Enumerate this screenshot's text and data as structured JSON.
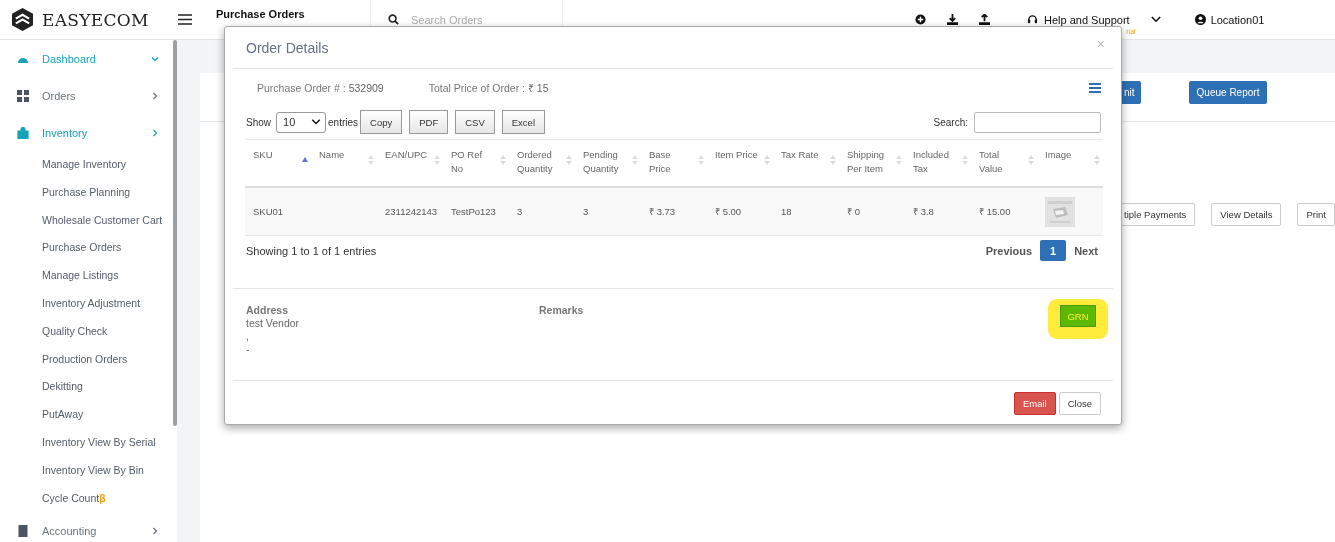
{
  "header": {
    "logo": "EASYECOM",
    "page_title": "Purchase Orders",
    "search": {
      "placeholder": "Search Orders"
    },
    "help": "Help and Support",
    "help_badge": "rial",
    "location": "Location01"
  },
  "sidebar": {
    "items": [
      {
        "label": "Dashboard",
        "active": true,
        "expanded": true
      },
      {
        "label": "Orders",
        "active": false,
        "expanded": false
      },
      {
        "label": "Inventory",
        "active": true,
        "expanded": false,
        "children": [
          {
            "label": "Manage Inventory"
          },
          {
            "label": "Purchase Planning"
          },
          {
            "label": "Wholesale Customer Cart"
          },
          {
            "label": "Purchase Orders"
          },
          {
            "label": "Manage Listings"
          },
          {
            "label": "Inventory Adjustment"
          },
          {
            "label": "Quality Check"
          },
          {
            "label": "Production Orders"
          },
          {
            "label": "Dekitting"
          },
          {
            "label": "PutAway"
          },
          {
            "label": "Inventory View By Serial"
          },
          {
            "label": "Inventory View By Bin"
          },
          {
            "label": "Cycle Count",
            "badge": "β"
          }
        ]
      },
      {
        "label": "Accounting",
        "active": false,
        "expanded": false
      }
    ]
  },
  "background_page": {
    "top_buttons": [
      {
        "label": "nit",
        "kind": "primary"
      },
      {
        "label": "Queue Report",
        "kind": "primary"
      }
    ],
    "row_buttons": [
      {
        "label": "tiple Payments"
      },
      {
        "label": "View Details"
      },
      {
        "label": "Print"
      }
    ]
  },
  "modal": {
    "title": "Order Details",
    "close": "×",
    "po_label": "Purchase Order # :",
    "po_value": "532909",
    "total_label": "Total Price of Order :",
    "total_value": "₹ 15",
    "show_label": "Show",
    "page_size": "10",
    "entries_label": "entries",
    "export_buttons": [
      "Copy",
      "PDF",
      "CSV",
      "Excel"
    ],
    "search_label": "Search:",
    "columns": [
      {
        "label": "SKU",
        "sorted": true
      },
      {
        "label": "Name",
        "sorted": false
      },
      {
        "label": "EAN/UPC",
        "sorted": false
      },
      {
        "label": "PO Ref No",
        "sorted": false
      },
      {
        "label": "Ordered Quantity",
        "sorted": false
      },
      {
        "label": "Pending Quantity",
        "sorted": false
      },
      {
        "label": "Base Price",
        "sorted": false
      },
      {
        "label": "Item Price",
        "sorted": false
      },
      {
        "label": "Tax Rate",
        "sorted": false
      },
      {
        "label": "Shipping Per Item",
        "sorted": false
      },
      {
        "label": "Included Tax",
        "sorted": false
      },
      {
        "label": "Total Value",
        "sorted": false
      },
      {
        "label": "Image",
        "sorted": false
      }
    ],
    "rows": [
      {
        "cells": [
          "SKU01",
          "",
          "2311242143",
          "TestPo123",
          "3",
          "3",
          "₹ 3.73",
          "₹ 5.00",
          "18",
          "₹ 0",
          "₹ 3.8",
          "₹ 15.00",
          {
            "kind": "picture"
          }
        ]
      }
    ],
    "info": "Showing 1 to 1 of 1 entries",
    "pagination": [
      {
        "label": "Previous",
        "selected": false
      },
      {
        "label": "1",
        "selected": true
      },
      {
        "label": "Next",
        "selected": false
      }
    ],
    "address_label": "Address",
    "address_lines": [
      "test Vendor",
      ",",
      "-"
    ],
    "remarks_label": "Remarks",
    "grn_button": "GRN",
    "grn_highlighted": true,
    "footer_buttons": [
      {
        "label": "Email",
        "kind": "danger"
      },
      {
        "label": "Close",
        "kind": "default"
      }
    ]
  }
}
